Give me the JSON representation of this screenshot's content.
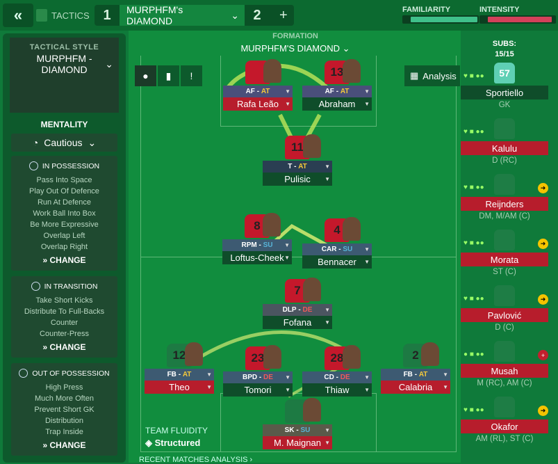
{
  "header": {
    "back": "«",
    "tactics_label": "TACTICS",
    "tab1": "1",
    "tab_active": "MURPHFM's DIAMOND",
    "tab2": "2",
    "plus": "+"
  },
  "meters": {
    "familiarity": "FAMILIARITY",
    "intensity": "INTENSITY"
  },
  "sidebar": {
    "style_label": "TACTICAL STYLE",
    "style_name_1": "MURPHFM -",
    "style_name_2": "DIAMOND",
    "mentality_label": "MENTALITY",
    "mentality_value": "Cautious",
    "in_possession": {
      "title": "IN POSSESSION",
      "items": [
        "Pass Into Space",
        "Play Out Of Defence",
        "Run At Defence",
        "Work Ball Into Box",
        "Be More Expressive",
        "Overlap Left",
        "Overlap Right"
      ],
      "change": "CHANGE"
    },
    "in_transition": {
      "title": "IN TRANSITION",
      "items": [
        "Take Short Kicks",
        "Distribute To Full-Backs",
        "Counter",
        "Counter-Press"
      ],
      "change": "CHANGE"
    },
    "out_of_possession": {
      "title": "OUT OF POSSESSION",
      "items": [
        "High Press",
        "Much More Often",
        "Prevent Short GK",
        "Distribution",
        "Trap Inside"
      ],
      "change": "CHANGE"
    }
  },
  "formation": {
    "label": "FORMATION",
    "name": "MURPHFM'S DIAMOND"
  },
  "analysis": "Analysis",
  "players": [
    {
      "num": "",
      "role": "AF",
      "duty": "AT",
      "name": "Rafa Leão"
    },
    {
      "num": "13",
      "role": "AF",
      "duty": "AT",
      "name": "Abraham"
    },
    {
      "num": "11",
      "role": "T",
      "duty": "AT",
      "name": "Pulisic"
    },
    {
      "num": "8",
      "role": "RPM",
      "duty": "SU",
      "name": "Loftus-Cheek"
    },
    {
      "num": "4",
      "role": "CAR",
      "duty": "SU",
      "name": "Bennacer"
    },
    {
      "num": "7",
      "role": "DLP",
      "duty": "DE",
      "name": "Fofana"
    },
    {
      "num": "12",
      "role": "FB",
      "duty": "AT",
      "name": "Theo"
    },
    {
      "num": "23",
      "role": "BPD",
      "duty": "DE",
      "name": "Tomori"
    },
    {
      "num": "28",
      "role": "CD",
      "duty": "DE",
      "name": "Thiaw"
    },
    {
      "num": "2",
      "role": "FB",
      "duty": "AT",
      "name": "Calabria"
    },
    {
      "num": "",
      "role": "SK",
      "duty": "SU",
      "name": "M. Maignan"
    }
  ],
  "subs_header": {
    "label": "SUBS:",
    "count": "15/15"
  },
  "subs": [
    {
      "num": "57",
      "name": "Sportiello",
      "pos": "GK"
    },
    {
      "num": "",
      "name": "Kalulu",
      "pos": "D (RC)"
    },
    {
      "num": "",
      "name": "Reijnders",
      "pos": "DM, M/AM (C)"
    },
    {
      "num": "",
      "name": "Morata",
      "pos": "ST (C)"
    },
    {
      "num": "",
      "name": "Pavlović",
      "pos": "D (C)"
    },
    {
      "num": "",
      "name": "Musah",
      "pos": "M (RC), AM (C)"
    },
    {
      "num": "",
      "name": "Okafor",
      "pos": "AM (RL), ST (C)"
    }
  ],
  "fluidity": {
    "label": "TEAM FLUIDITY",
    "value": "Structured"
  },
  "recent": "RECENT MATCHES ANALYSIS ›"
}
